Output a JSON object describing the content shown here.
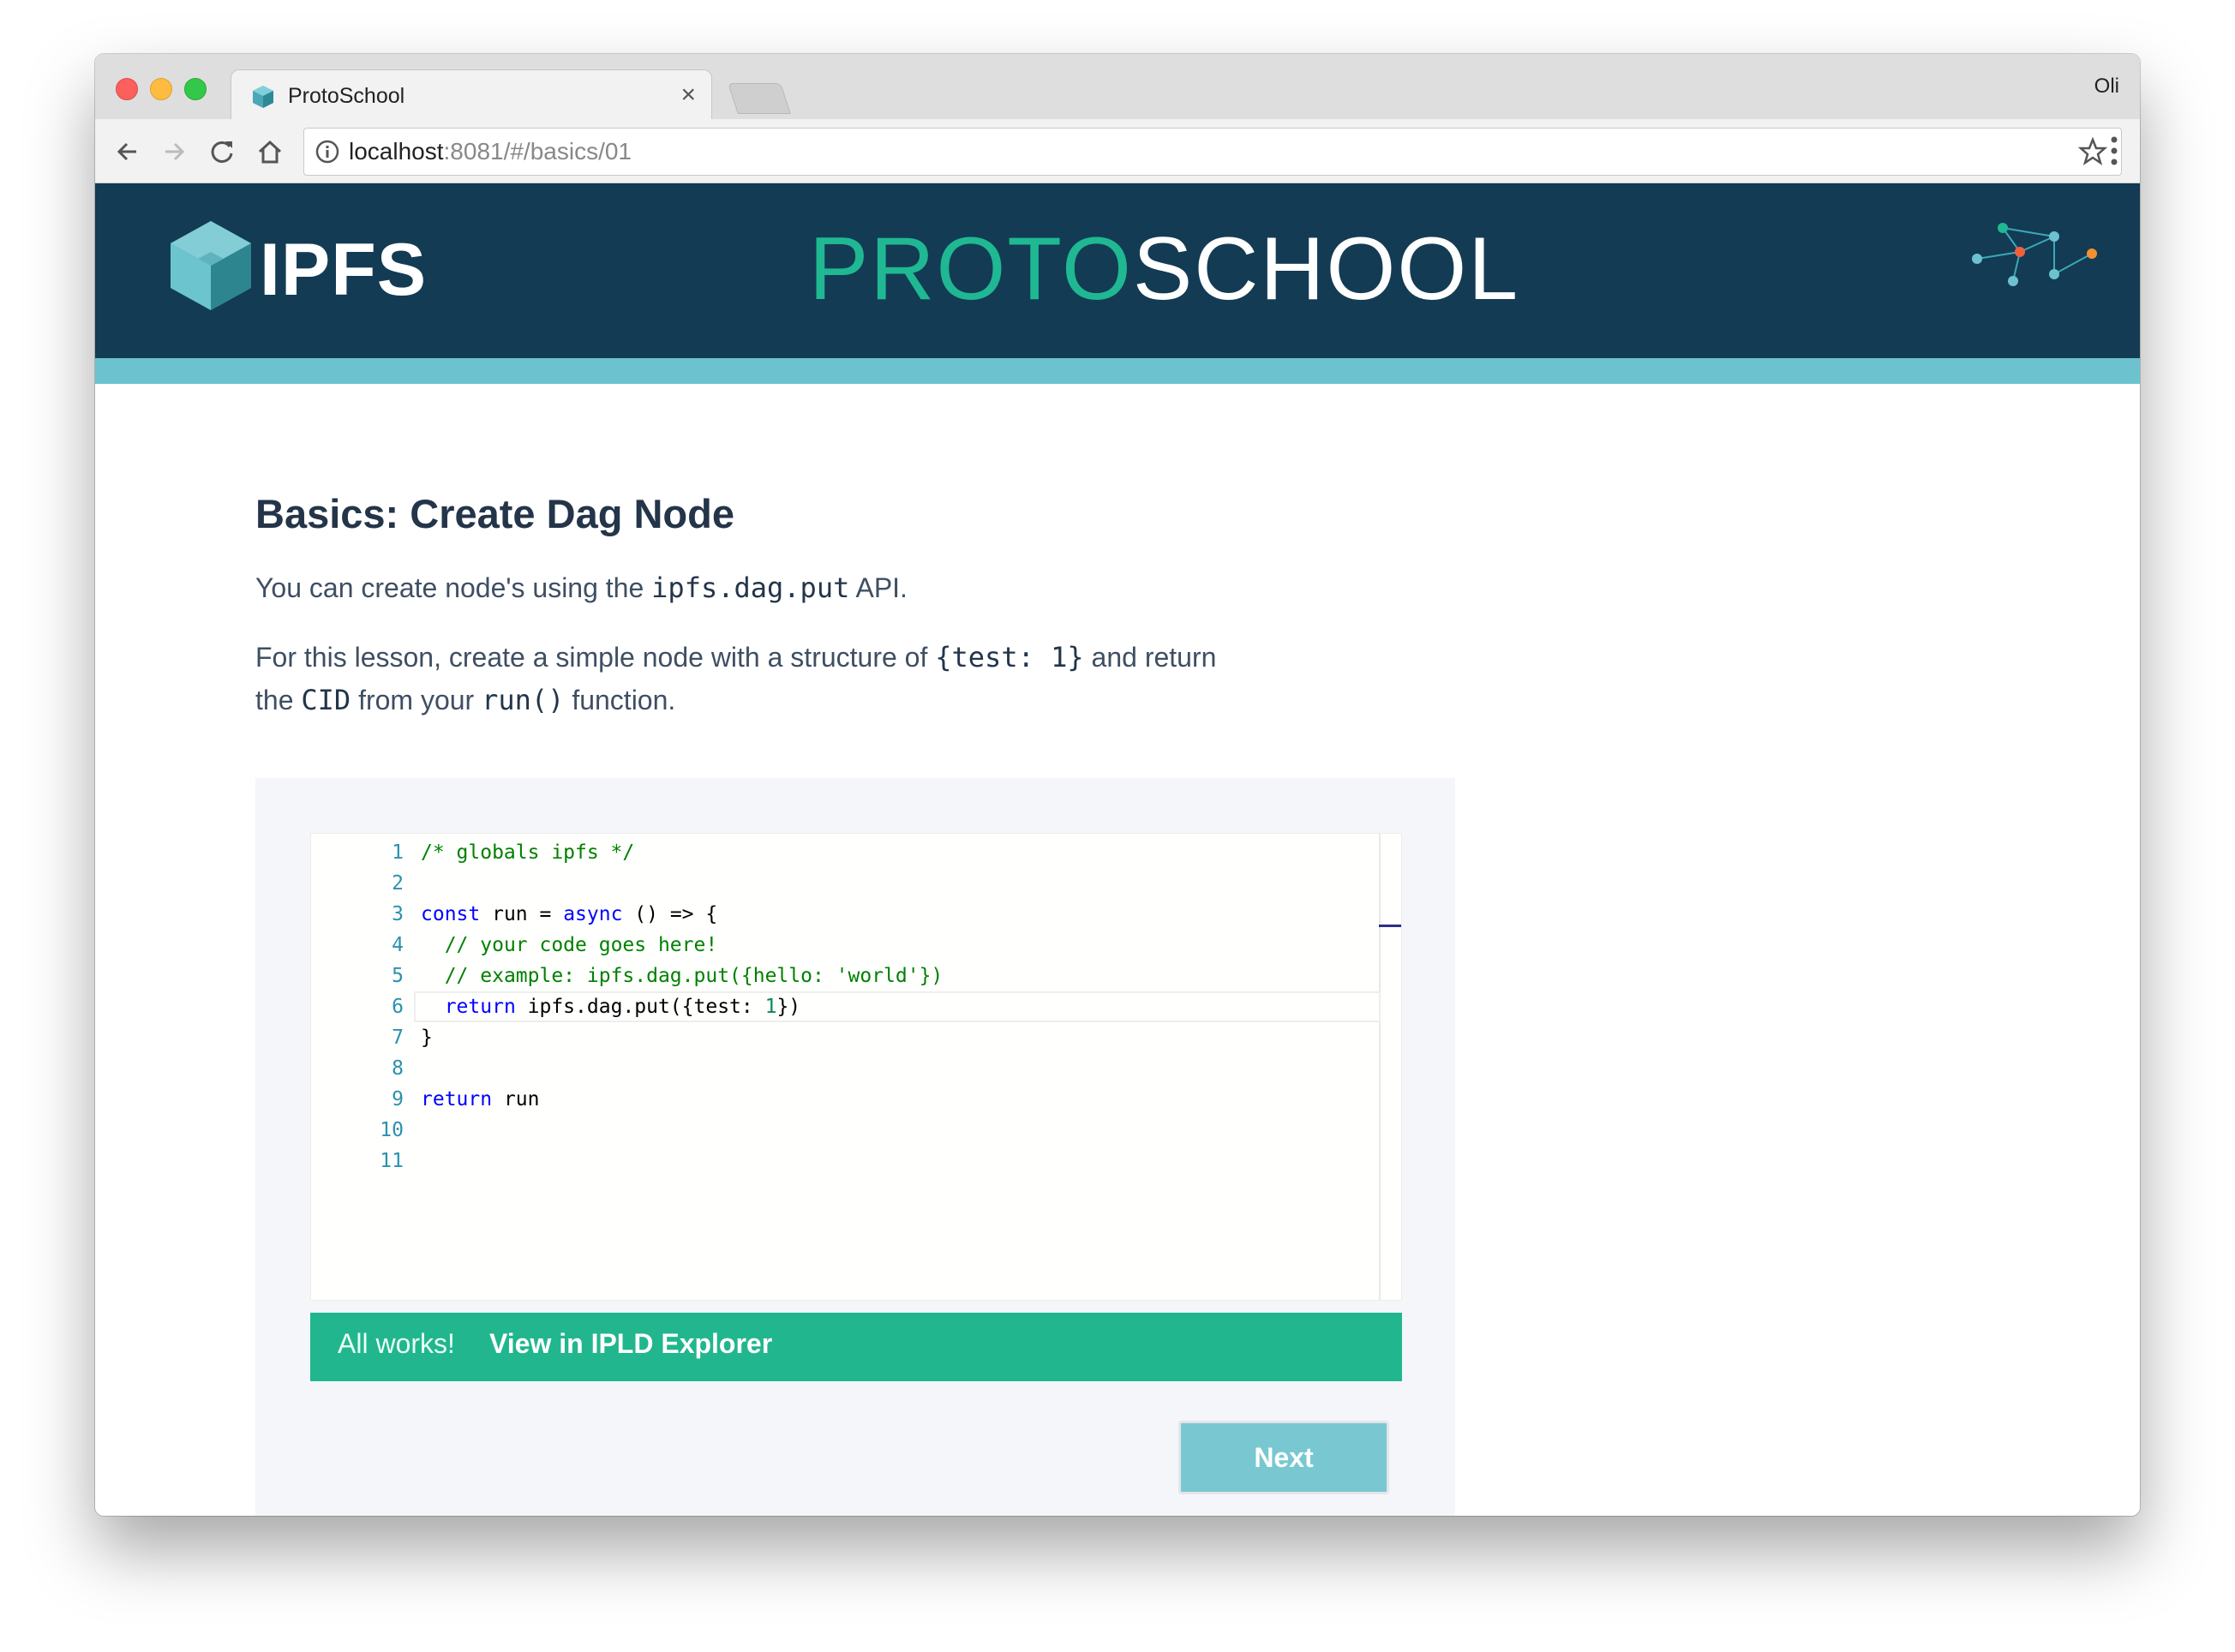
{
  "browser": {
    "tab_title": "ProtoSchool",
    "tab_close": "×",
    "profile_name": "Oli",
    "url_host": "localhost",
    "url_rest": ":8081/#/basics/01"
  },
  "header": {
    "ipfs_word": "IPFS",
    "brand_proto": "PROTO",
    "brand_school": "SCHOOL",
    "colors": {
      "navy": "#133b54",
      "teal": "#1fb892",
      "stripe": "#6cc3cf"
    }
  },
  "lesson": {
    "title": "Basics: Create Dag Node",
    "p1_before": "You can create node's using the ",
    "p1_code": "ipfs.dag.put",
    "p1_after": " API.",
    "p2_a": "For this lesson, create a simple node with a structure of ",
    "p2_code1": "{test: 1}",
    "p2_b": " and return the ",
    "p2_code2": "CID",
    "p2_c": " from your ",
    "p2_code3": "run()",
    "p2_d": " function."
  },
  "editor": {
    "lines": [
      {
        "n": "1",
        "parts": [
          [
            "cm",
            "/* globals ipfs */"
          ]
        ]
      },
      {
        "n": "2",
        "parts": []
      },
      {
        "n": "3",
        "parts": [
          [
            "kw",
            "const"
          ],
          [
            "",
            " run = "
          ],
          [
            "kw",
            "async"
          ],
          [
            "",
            " () => {"
          ]
        ]
      },
      {
        "n": "4",
        "parts": [
          [
            "",
            "  "
          ],
          [
            "cm",
            "// your code goes here!"
          ]
        ]
      },
      {
        "n": "5",
        "parts": [
          [
            "",
            "  "
          ],
          [
            "cm",
            "// example: ipfs.dag.put({hello: 'world'})"
          ]
        ]
      },
      {
        "n": "6",
        "parts": [
          [
            "",
            "  "
          ],
          [
            "kw",
            "return"
          ],
          [
            "",
            " ipfs.dag.put({test: "
          ],
          [
            "num",
            "1"
          ],
          [
            "",
            "})"
          ]
        ]
      },
      {
        "n": "7",
        "parts": [
          [
            "",
            "}"
          ]
        ]
      },
      {
        "n": "8",
        "parts": []
      },
      {
        "n": "9",
        "parts": [
          [
            "kw",
            "return"
          ],
          [
            "",
            " run"
          ]
        ]
      },
      {
        "n": "10",
        "parts": []
      },
      {
        "n": "11",
        "parts": []
      }
    ]
  },
  "status": {
    "message": "All works!",
    "link": "View in IPLD Explorer"
  },
  "next_label": "Next"
}
